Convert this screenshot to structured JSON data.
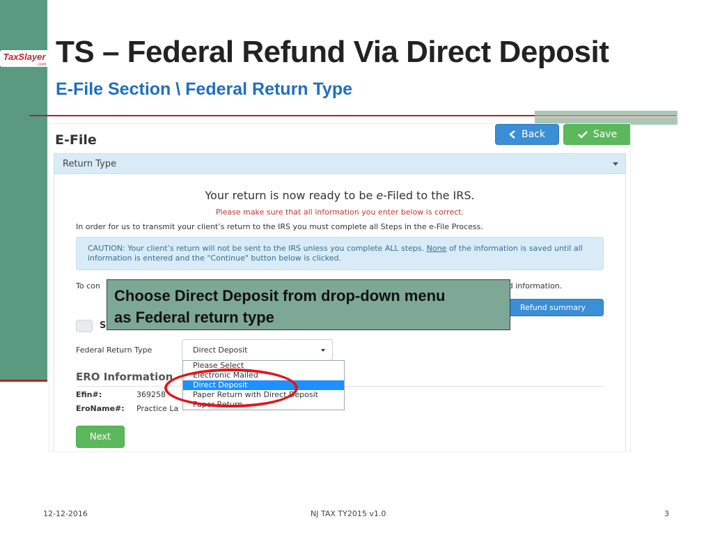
{
  "slide": {
    "title": "TS – Federal Refund Via Direct Deposit",
    "subtitle": "E-File Section \\ Federal Return Type",
    "logo_text": "TaxSlayer",
    "logo_sub": ".com",
    "colors": {
      "sidebar": "#5a9a80",
      "rule": "#a52a2a",
      "subtitle": "#1f6fbf",
      "callout": "#7ea896",
      "highlight": "#e0161b"
    }
  },
  "app": {
    "section_title": "E-File",
    "back_label": "Back",
    "save_label": "Save",
    "panel_title": "Return Type",
    "ready_pre": "Your return is now ready to be ",
    "ready_em": "e",
    "ready_post": "-Filed to the IRS.",
    "warning": "Please make sure that all information you enter below is correct.",
    "transmit_text": "In order for us to transmit your client’s return to the IRS you must complete all Steps in the e-File Process.",
    "caution_pre": "CAUTION: Your client’s return will not be sent to the IRS unless you complete ALL steps. ",
    "caution_none": "None",
    "caution_post": " of the information is saved until all information is entered and the \"Continue\" button below is clicked.",
    "to_con": "To con",
    "tail_text": "ed information.",
    "refund_summary_label": "Refund summary",
    "checkbox_label": "S",
    "federal_return_type_label": "Federal Return Type",
    "federal_return_type_value": "Direct Deposit",
    "dropdown_options": [
      "Please Select",
      "Electronic Mailed",
      "Direct Deposit",
      "Paper Return with Direct Deposit",
      "Paper Return"
    ],
    "ero_title": "ERO Information",
    "efin_label": "Efin#:",
    "efin_value": "369258",
    "eroname_label": "EroName#:",
    "eroname_value": "Practice La",
    "next_label": "Next"
  },
  "callout": {
    "line1": "Choose Direct Deposit from drop-down menu",
    "line2": "as Federal return type"
  },
  "footer": {
    "date": "12-12-2016",
    "center": "NJ TAX TY2015 v1.0",
    "page": "3"
  }
}
